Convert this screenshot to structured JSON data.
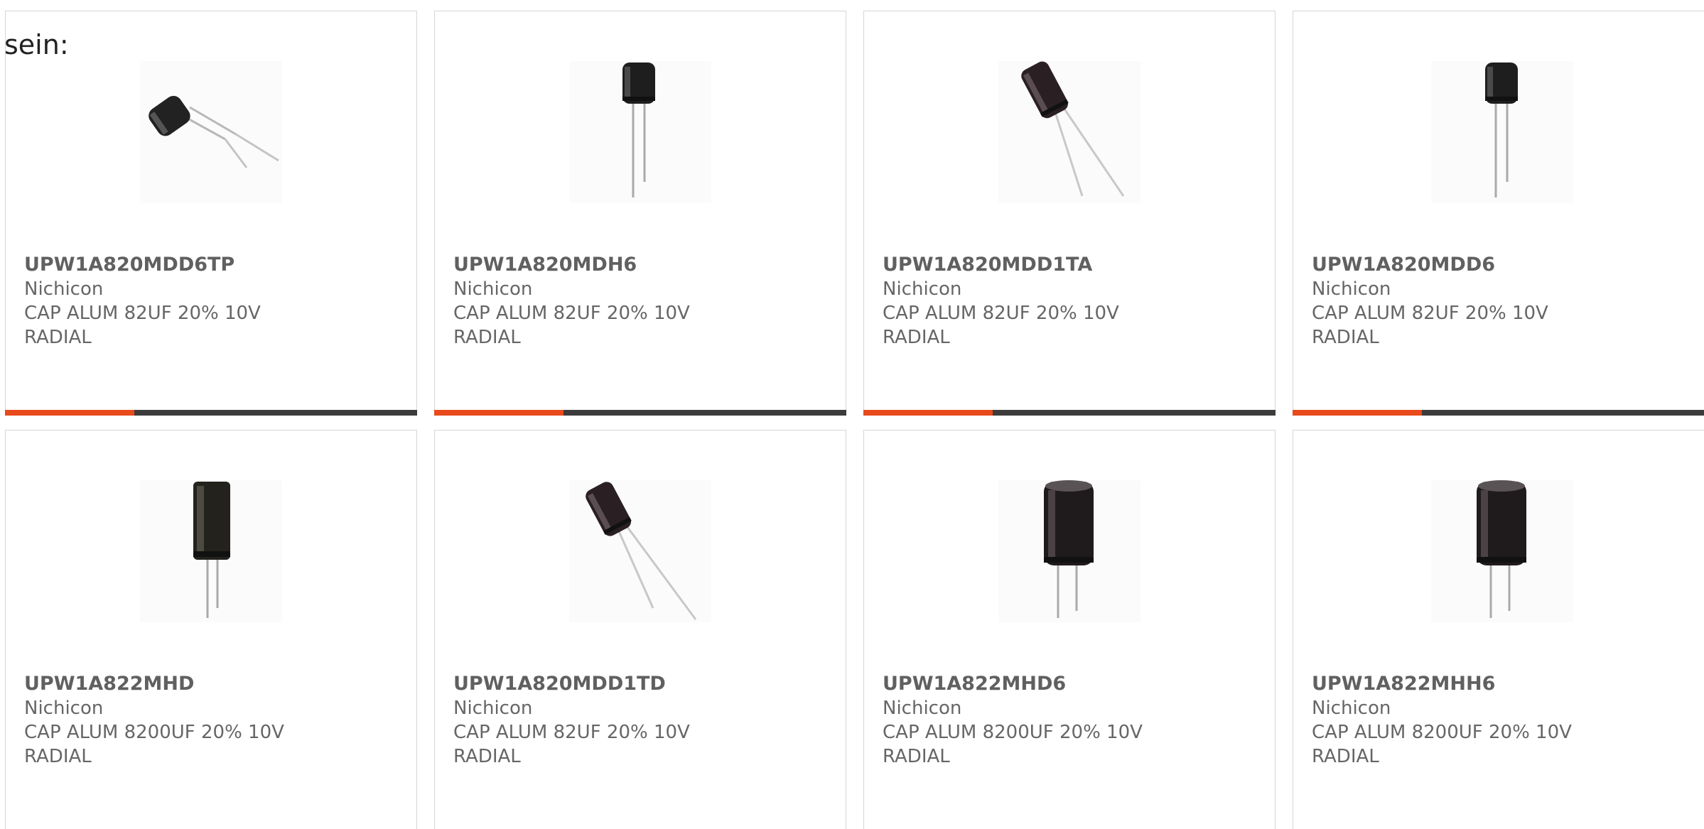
{
  "intro_text": "sein:",
  "colors": {
    "accent": "#e84a1c",
    "bar": "#3c3c3c",
    "border": "#d6d6d6",
    "text": "#666666"
  },
  "products": [
    {
      "part_number": "UPW1A820MDD6TP",
      "manufacturer": "Nichicon",
      "description_line1": "CAP ALUM 82UF 20% 10V",
      "description_line2": "RADIAL",
      "image_icon": "capacitor-tilted-small-icon"
    },
    {
      "part_number": "UPW1A820MDH6",
      "manufacturer": "Nichicon",
      "description_line1": "CAP ALUM 82UF 20% 10V",
      "description_line2": "RADIAL",
      "image_icon": "capacitor-upright-small-icon"
    },
    {
      "part_number": "UPW1A820MDD1TA",
      "manufacturer": "Nichicon",
      "description_line1": "CAP ALUM 82UF 20% 10V",
      "description_line2": "RADIAL",
      "image_icon": "capacitor-tilted-icon"
    },
    {
      "part_number": "UPW1A820MDD6",
      "manufacturer": "Nichicon",
      "description_line1": "CAP ALUM 82UF 20% 10V",
      "description_line2": "RADIAL",
      "image_icon": "capacitor-upright-small-icon"
    },
    {
      "part_number": "UPW1A822MHD",
      "manufacturer": "Nichicon",
      "description_line1": "CAP ALUM 8200UF 20% 10V",
      "description_line2": "RADIAL",
      "image_icon": "capacitor-tall-icon"
    },
    {
      "part_number": "UPW1A820MDD1TD",
      "manufacturer": "Nichicon",
      "description_line1": "CAP ALUM 82UF 20% 10V",
      "description_line2": "RADIAL",
      "image_icon": "capacitor-tilted-icon"
    },
    {
      "part_number": "UPW1A822MHD6",
      "manufacturer": "Nichicon",
      "description_line1": "CAP ALUM 8200UF 20% 10V",
      "description_line2": "RADIAL",
      "image_icon": "capacitor-large-icon"
    },
    {
      "part_number": "UPW1A822MHH6",
      "manufacturer": "Nichicon",
      "description_line1": "CAP ALUM 8200UF 20% 10V",
      "description_line2": "RADIAL",
      "image_icon": "capacitor-large-icon"
    }
  ]
}
